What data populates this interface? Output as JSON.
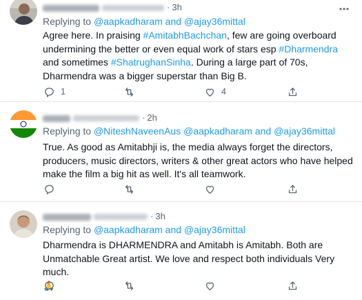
{
  "tweets": [
    {
      "time": "3h",
      "replying_label": "Replying to",
      "reply_mentions": "@aapkadharam",
      "reply_and": " and ",
      "reply_mention2": "@ajay36mittal",
      "body": [
        {
          "t": "Agree here. In praising ",
          "h": false
        },
        {
          "t": "#AmitabhBachchan",
          "h": true
        },
        {
          "t": ", few are going overboard undermining the better or even equal work of stars esp ",
          "h": false
        },
        {
          "t": "#Dharmendra",
          "h": true
        },
        {
          "t": " and sometimes ",
          "h": false
        },
        {
          "t": "#ShatrughanSinha",
          "h": true
        },
        {
          "t": ". During a large part of 70s, Dharmendra was a bigger superstar than Big B.",
          "h": false
        }
      ],
      "reply_count": "1",
      "retweet_count": "",
      "like_count": "4"
    },
    {
      "time": "2h",
      "replying_label": "Replying to",
      "reply_mentions": "@NiteshNaveenAus @aapkadharam",
      "reply_and": " and ",
      "reply_mention2": "@ajay36mittal",
      "body": [
        {
          "t": "True. As good as Amitabhji is, the media always forget the directors, producers, music directors, writers & other great actors who have helped make the film a big hit as well. It's all teamwork.",
          "h": false
        }
      ],
      "reply_count": "",
      "retweet_count": "",
      "like_count": ""
    },
    {
      "time": "3h",
      "replying_label": "Replying to",
      "reply_mentions": "@aapkadharam",
      "reply_and": " and ",
      "reply_mention2": "@ajay36mittal",
      "body": [
        {
          "t": "Dharmendra is DHARMENDRA and Amitabh is Amitabh. Both are Unmatchable Great artist. We love and respect both  individuals Very much.",
          "h": false
        }
      ],
      "emoji": "🙏",
      "reply_count": "",
      "retweet_count": "",
      "like_count": ""
    }
  ],
  "colors": {
    "link": "#1d9bf0",
    "muted": "#536471",
    "text": "#0f1419",
    "divider": "#e1e6ea"
  },
  "icons": {
    "more": "more-icon",
    "reply": "reply-icon",
    "retweet": "retweet-icon",
    "like": "like-icon",
    "share": "share-icon"
  }
}
